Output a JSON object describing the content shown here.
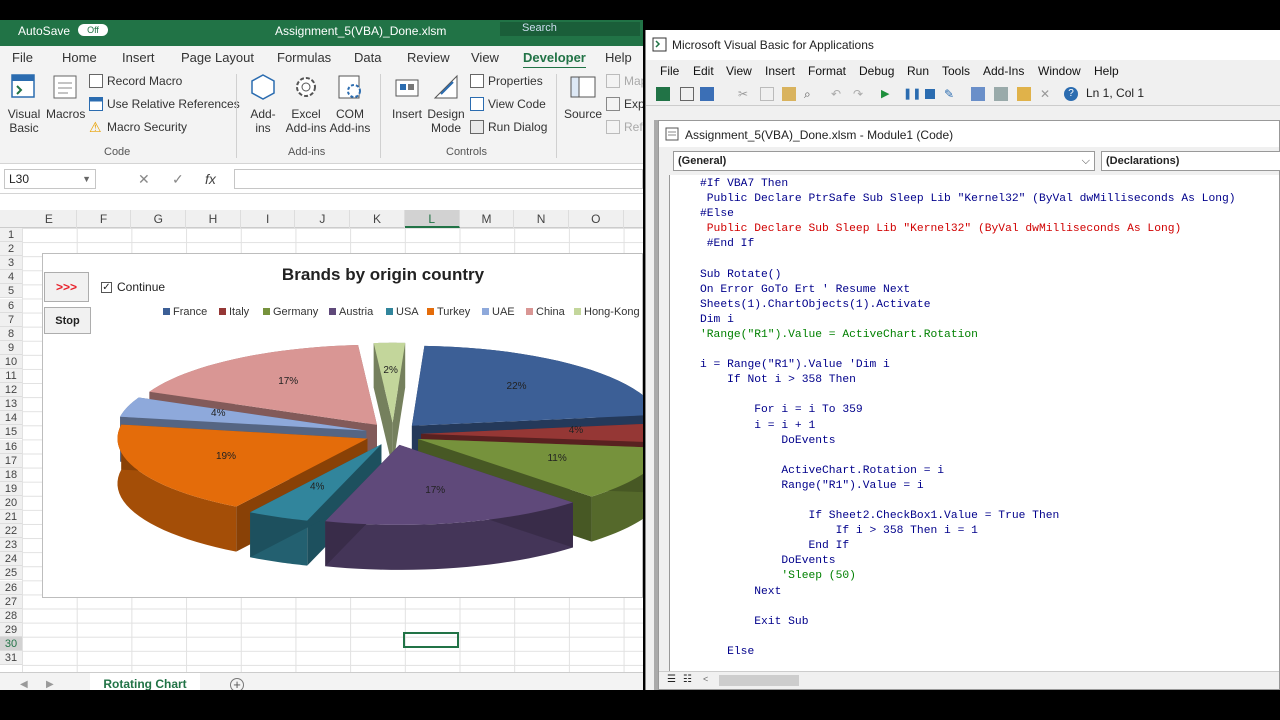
{
  "excel": {
    "autosave": "AutoSave",
    "autosave_state": "Off",
    "doc_title": "Assignment_5(VBA)_Done.xlsm",
    "search_placeholder": "Search",
    "tabs": [
      "File",
      "Home",
      "Insert",
      "Page Layout",
      "Formulas",
      "Data",
      "Review",
      "View",
      "Developer",
      "Help"
    ],
    "active_tab": "Developer",
    "ribbon": {
      "visual_basic": "Visual\nBasic",
      "macros": "Macros",
      "record_macro": "Record Macro",
      "relative_refs": "Use Relative References",
      "macro_security": "Macro Security",
      "group_code": "Code",
      "addins": "Add-\nins",
      "excel_addins": "Excel\nAdd-ins",
      "com_addins": "COM\nAdd-ins",
      "group_addins": "Add-ins",
      "insert": "Insert",
      "design_mode": "Design\nMode",
      "properties": "Properties",
      "view_code": "View Code",
      "run_dialog": "Run Dialog",
      "group_controls": "Controls",
      "source": "Source",
      "map": "Map",
      "exp": "Exp",
      "ref": "Refr"
    },
    "name_box": "L30",
    "columns": [
      "E",
      "F",
      "G",
      "H",
      "I",
      "J",
      "K",
      "L",
      "M",
      "N",
      "O"
    ],
    "selected_col": "L",
    "rows": [
      "1",
      "2",
      "3",
      "4",
      "5",
      "6",
      "7",
      "8",
      "9",
      "10",
      "11",
      "12",
      "13",
      "14",
      "15",
      "16",
      "17",
      "18",
      "19",
      "20",
      "21",
      "22",
      "23",
      "24",
      "25",
      "26",
      "27",
      "28",
      "29",
      "30",
      "31"
    ],
    "selected_row": "30",
    "button_go": ">>>",
    "button_stop": "Stop",
    "checkbox_label": "Continue",
    "checkbox_checked": true,
    "sheet_tab": "Rotating Chart"
  },
  "chart_data": {
    "type": "pie",
    "title": "Brands by origin country",
    "legend_position": "top",
    "categories": [
      "France",
      "Italy",
      "Germany",
      "Austria",
      "USA",
      "Turkey",
      "UAE",
      "China",
      "Hong-Kong"
    ],
    "values": [
      22,
      4,
      11,
      17,
      4,
      19,
      4,
      17,
      2
    ],
    "labels": [
      "22%",
      "4%",
      "11%",
      "17%",
      "4%",
      "19%",
      "4%",
      "17%",
      "2%"
    ],
    "colors": [
      "#3c5f96",
      "#953735",
      "#76923c",
      "#5f497a",
      "#31859c",
      "#e46c0a",
      "#8ea9db",
      "#d99694",
      "#c3d69b"
    ],
    "exploded": true,
    "three_d": true
  },
  "vba": {
    "window_title": "Microsoft Visual Basic for Applications",
    "menu": [
      "File",
      "Edit",
      "View",
      "Insert",
      "Format",
      "Debug",
      "Run",
      "Tools",
      "Add-Ins",
      "Window",
      "Help"
    ],
    "cursor_pos": "Ln 1, Col 1",
    "code_window_title": "Assignment_5(VBA)_Done.xlsm - Module1 (Code)",
    "object_combo": "(General)",
    "proc_combo": "(Declarations)",
    "code_lines": [
      {
        "t": "#If VBA7 Then",
        "c": "kw"
      },
      {
        "t": " Public Declare PtrSafe Sub Sleep Lib \"Kernel32\" (ByVal dwMilliseconds As Long)",
        "c": "kw"
      },
      {
        "t": "#Else",
        "c": "kw"
      },
      {
        "t": " Public Declare Sub Sleep Lib \"Kernel32\" (ByVal dwMilliseconds As Long)",
        "c": "err"
      },
      {
        "t": " #End If",
        "c": "kw"
      },
      {
        "t": "",
        "c": ""
      },
      {
        "t": "Sub Rotate()",
        "c": "kw"
      },
      {
        "t": "On Error GoTo Ert ' Resume Next",
        "c": "kw"
      },
      {
        "t": "Sheets(1).ChartObjects(1).Activate",
        "c": "kw"
      },
      {
        "t": "Dim i",
        "c": "kw"
      },
      {
        "t": "'Range(\"R1\").Value = ActiveChart.Rotation",
        "c": "cm"
      },
      {
        "t": "",
        "c": ""
      },
      {
        "t": "i = Range(\"R1\").Value 'Dim i",
        "c": "kw"
      },
      {
        "t": "    If Not i > 358 Then",
        "c": "kw"
      },
      {
        "t": "",
        "c": ""
      },
      {
        "t": "        For i = i To 359",
        "c": "kw"
      },
      {
        "t": "        i = i + 1",
        "c": "kw"
      },
      {
        "t": "            DoEvents",
        "c": "kw"
      },
      {
        "t": "",
        "c": ""
      },
      {
        "t": "            ActiveChart.Rotation = i",
        "c": "kw"
      },
      {
        "t": "            Range(\"R1\").Value = i",
        "c": "kw"
      },
      {
        "t": "",
        "c": ""
      },
      {
        "t": "                If Sheet2.CheckBox1.Value = True Then",
        "c": "kw"
      },
      {
        "t": "                    If i > 358 Then i = 1",
        "c": "kw"
      },
      {
        "t": "                End If",
        "c": "kw"
      },
      {
        "t": "            DoEvents",
        "c": "kw"
      },
      {
        "t": "            'Sleep (50)",
        "c": "cm"
      },
      {
        "t": "        Next",
        "c": "kw"
      },
      {
        "t": "",
        "c": ""
      },
      {
        "t": "        Exit Sub",
        "c": "kw"
      },
      {
        "t": "",
        "c": ""
      },
      {
        "t": "    Else",
        "c": "kw"
      }
    ]
  }
}
